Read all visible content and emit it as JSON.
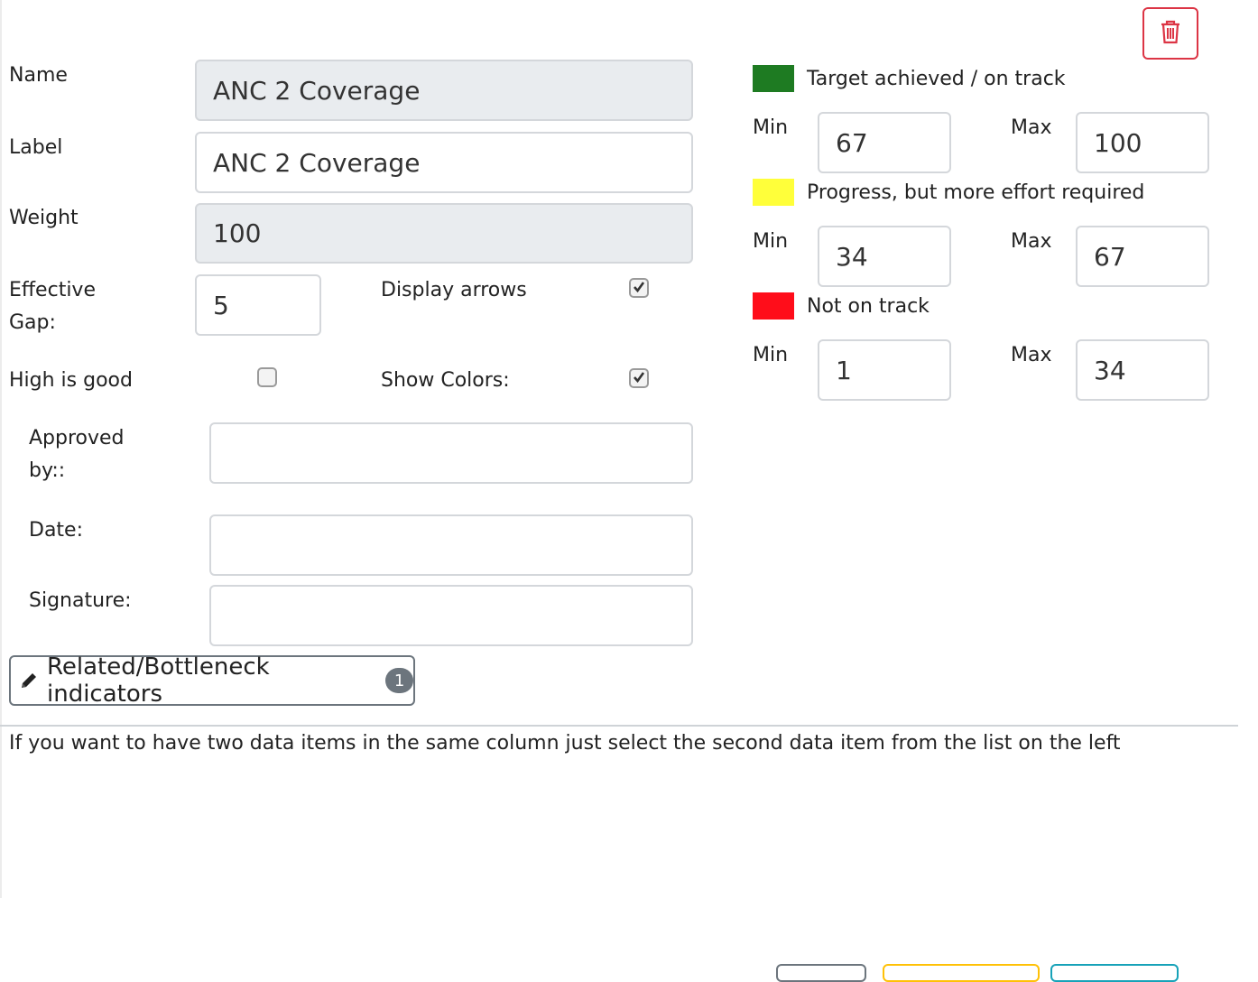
{
  "form": {
    "name_label": "Name",
    "name_value": "ANC 2 Coverage",
    "label_label": "Label",
    "label_value": "ANC 2 Coverage",
    "weight_label": "Weight",
    "weight_value": "100",
    "effective_gap_label_line1": "Effective",
    "effective_gap_label_line2": "Gap:",
    "effective_gap_value": "5",
    "display_arrows_label": "Display arrows",
    "display_arrows_checked": true,
    "high_is_good_label": "High is good",
    "high_is_good_checked": false,
    "show_colors_label": "Show Colors:",
    "show_colors_checked": true,
    "approved_by_label_line1": "Approved",
    "approved_by_label_line2": "by::",
    "approved_by_value": "",
    "date_label": "Date:",
    "date_value": "",
    "signature_label": "Signature:",
    "signature_value": ""
  },
  "thresholds": {
    "min_label": "Min",
    "max_label": "Max",
    "items": [
      {
        "label": "Target achieved / on track",
        "color": "#1e7b22",
        "min": "67",
        "max": "100"
      },
      {
        "label": "Progress, but more effort required",
        "color": "#ffff3a",
        "min": "34",
        "max": "67"
      },
      {
        "label": "Not on track",
        "color": "#ff0d1a",
        "min": "1",
        "max": "34"
      }
    ]
  },
  "related_button": {
    "label": "Related/Bottleneck indicators",
    "badge": "1",
    "icon": "pencil-icon"
  },
  "delete_button": {
    "icon": "trash-icon",
    "color": "#dc3545"
  },
  "hint_text": "If you want to have two data items in the same column just select the second data item from the list on the left",
  "footer_buttons": [
    {
      "color": "#6c757d"
    },
    {
      "color": "#ffc107"
    },
    {
      "color": "#17a2b8"
    }
  ]
}
